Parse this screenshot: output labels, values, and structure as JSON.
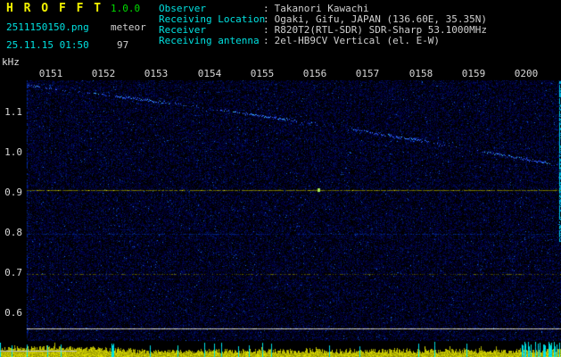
{
  "app": {
    "title": "H R O F F T",
    "version": "1.0.0",
    "filename": "2511150150.png",
    "mode": "meteor",
    "datetime": "25.11.15 01:50",
    "count": "97"
  },
  "info": {
    "separator": ":",
    "rows": [
      {
        "label": "Observer",
        "value": "Takanori Kawachi"
      },
      {
        "label": "Receiving Location",
        "value": "Ogaki, Gifu, JAPAN (136.60E, 35.35N)"
      },
      {
        "label": "Receiver",
        "value": "R820T2(RTL-SDR) SDR-Sharp 53.1000MHz"
      },
      {
        "label": "Receiving antenna",
        "value": "2el-HB9CV Vertical (el. E-W)"
      }
    ]
  },
  "chart_data": {
    "type": "heatmap",
    "title": "HROFFT 10-minute radio meteor observation spectrogram",
    "x": {
      "tick_labels": [
        "0151",
        "0152",
        "0153",
        "0154",
        "0155",
        "0156",
        "0157",
        "0158",
        "0159",
        "0200"
      ],
      "start_time": "0150",
      "end_time": "0200"
    },
    "y": {
      "label": "kHz",
      "tick_labels": [
        "1.1",
        "1.0",
        "0.9",
        "0.8",
        "0.7",
        "0.6"
      ],
      "range_khz": [
        0.55,
        1.18
      ]
    },
    "features": {
      "drifting_carrier": {
        "description": "dotted blue trace drifting downward across the window",
        "start_khz": 1.17,
        "end_khz": 0.97
      },
      "carrier_line": {
        "khz": 0.91,
        "color": "#a0a000",
        "bright_spot_near": "0156"
      },
      "dotted_line_blue_khz": 0.8,
      "dotted_line_olive_khz": 0.7,
      "baseline_khz": 0.565,
      "right_edge_marker": {
        "color": "#00d2e6",
        "from_khz": 1.18,
        "to_khz": 0.78
      }
    },
    "level_bar": {
      "description": "signal-level bar strip along bottom with meteor echo spikes",
      "bar_color": "#c8c800",
      "echo_color": "#00e6e6"
    },
    "colors": {
      "background": "#000000",
      "noise_blue": "#000080",
      "text_cyan": "#00e0e0",
      "text_gray": "#cfcfcf",
      "title_yellow": "#f2f200",
      "version_green": "#00dd00"
    }
  }
}
